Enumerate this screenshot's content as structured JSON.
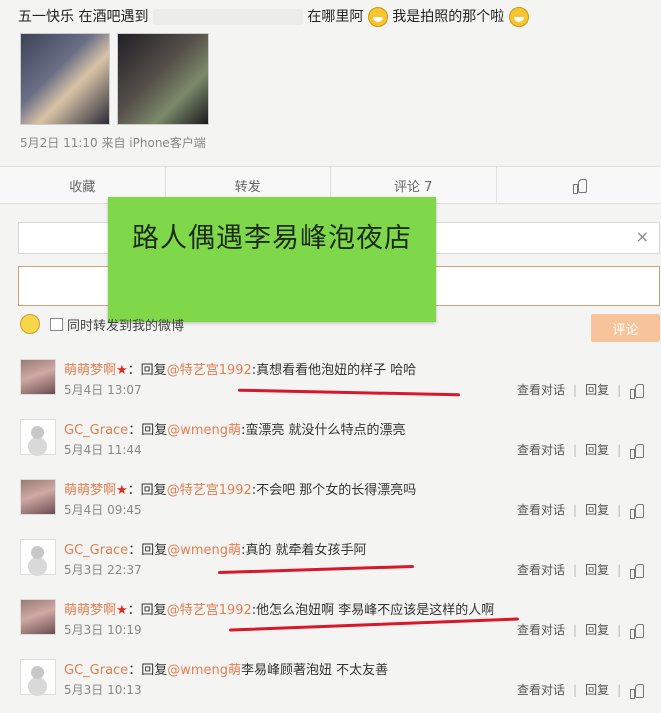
{
  "post": {
    "text_before": "五一快乐 在酒吧遇到",
    "text_after": "在哪里阿",
    "text_tail": "我是拍照的那个啦",
    "meta": "5月2日 11:10 来自 iPhone客户端"
  },
  "actions": [
    "收藏",
    "转发",
    "评论 7"
  ],
  "sticker_text": "路人偶遇李易峰泡夜店",
  "close_glyph": "×",
  "repost_option": "同时转发到我的微博",
  "submit_label": "评论",
  "comments": [
    {
      "user": "萌萌梦啊",
      "star": "★",
      "reply_prefix": "：回复",
      "mention": "@特艺宫1992",
      "text": ":真想看看他泡妞的样子 哈哈",
      "date": "5月4日 13:07",
      "avatar": "girl"
    },
    {
      "user": "GC_Grace",
      "star": "",
      "reply_prefix": "：回复",
      "mention": "@wmeng萌",
      "text": ":蛮漂亮 就没什么特点的漂亮",
      "date": "5月4日 11:44",
      "avatar": "grace"
    },
    {
      "user": "萌萌梦啊",
      "star": "★",
      "reply_prefix": "：回复",
      "mention": "@特艺宫1992",
      "text": ":不会吧 那个女的长得漂亮吗",
      "date": "5月4日 09:45",
      "avatar": "girl"
    },
    {
      "user": "GC_Grace",
      "star": "",
      "reply_prefix": "：回复",
      "mention": "@wmeng萌",
      "text": ":真的 就牵着女孩手阿",
      "date": "5月3日 22:37",
      "avatar": "grace"
    },
    {
      "user": "萌萌梦啊",
      "star": "★",
      "reply_prefix": "：回复",
      "mention": "@特艺宫1992",
      "text": ":他怎么泡妞啊 李易峰不应该是这样的人啊",
      "date": "5月3日 10:19",
      "avatar": "girl"
    },
    {
      "user": "GC_Grace",
      "star": "",
      "reply_prefix": "：回复",
      "mention": "@wmeng萌",
      "text": "李易峰顾著泡妞 不太友善",
      "date": "5月3日 10:13",
      "avatar": "grace"
    }
  ],
  "comment_actions": {
    "view": "查看对话",
    "reply": "回复"
  },
  "colors": {
    "sticker": "#7fd84a",
    "underline": "#d9172b",
    "username": "#e07f52"
  }
}
